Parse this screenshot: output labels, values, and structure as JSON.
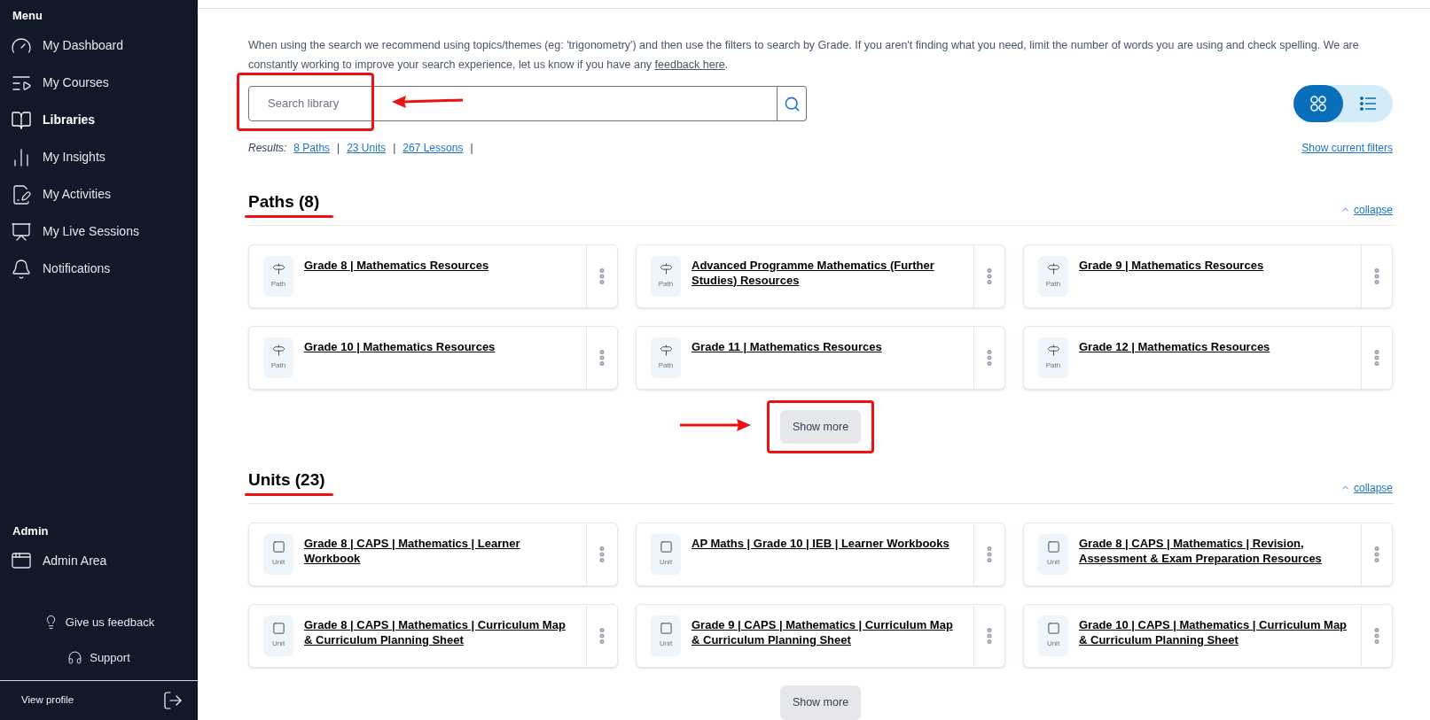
{
  "sidebar": {
    "menu_heading": "Menu",
    "items": [
      {
        "kind": "dashboard",
        "label": "My Dashboard",
        "selected": false
      },
      {
        "kind": "courses",
        "label": "My Courses",
        "selected": false
      },
      {
        "kind": "libraries",
        "label": "Libraries",
        "selected": true
      },
      {
        "kind": "insights",
        "label": "My Insights",
        "selected": false
      },
      {
        "kind": "activities",
        "label": "My Activities",
        "selected": false
      },
      {
        "kind": "live",
        "label": "My Live Sessions",
        "selected": false
      },
      {
        "kind": "notifications",
        "label": "Notifications",
        "selected": false
      }
    ],
    "admin_heading": "Admin",
    "admin_items": [
      {
        "kind": "admin",
        "label": "Admin Area",
        "selected": false
      }
    ],
    "feedback": "Give us feedback",
    "support": "Support",
    "profile": "View profile"
  },
  "intro": {
    "text": "When using the search we recommend using topics/themes (eg: 'trigonometry') and then use the filters to search by Grade. If you aren't finding what you need, limit the number of words you are using and check spelling. We are constantly working to improve your search experience, let us know if you have any ",
    "link": "feedback here",
    "after": "."
  },
  "search": {
    "placeholder": "Search library",
    "marked": true
  },
  "view_toggle": [
    {
      "kind": "grid",
      "selected": true
    },
    {
      "kind": "list",
      "selected": false
    }
  ],
  "results": {
    "label": "Results:",
    "links": [
      "8 Paths",
      "23 Units",
      "267 Lessons"
    ],
    "separator": "|",
    "filters_link": "Show current filters"
  },
  "sections": [
    {
      "title": "Paths (8)",
      "marked": true,
      "collapse": "collapse",
      "show_more": "Show more",
      "show_more_marked": true,
      "cards": [
        {
          "kind": "path",
          "title": "Grade 8 | Mathematics Resources",
          "type_label": "Path"
        },
        {
          "kind": "path",
          "title": "Advanced Programme Mathematics (Further Studies) Resources",
          "type_label": "Path"
        },
        {
          "kind": "path",
          "title": "Grade 9 | Mathematics Resources",
          "type_label": "Path"
        },
        {
          "kind": "path",
          "title": "Grade 10 | Mathematics Resources",
          "type_label": "Path"
        },
        {
          "kind": "path",
          "title": "Grade 11 | Mathematics Resources",
          "type_label": "Path"
        },
        {
          "kind": "path",
          "title": "Grade 12 | Mathematics Resources",
          "type_label": "Path"
        }
      ]
    },
    {
      "title": "Units (23)",
      "marked": true,
      "collapse": "collapse",
      "show_more": "Show more",
      "show_more_marked": false,
      "cards": [
        {
          "kind": "unit",
          "title": "Grade 8 | CAPS | Mathematics | Learner Workbook",
          "type_label": "Unit"
        },
        {
          "kind": "unit",
          "title": "AP Maths | Grade 10 | IEB | Learner Workbooks",
          "type_label": "Unit"
        },
        {
          "kind": "unit",
          "title": "Grade 8 | CAPS | Mathematics | Revision, Assessment & Exam Preparation Resources",
          "type_label": "Unit"
        },
        {
          "kind": "unit",
          "title": "Grade 8 | CAPS | Mathematics | Curriculum Map & Curriculum Planning Sheet",
          "type_label": "Unit"
        },
        {
          "kind": "unit",
          "title": "Grade 9 | CAPS | Mathematics | Curriculum Map & Curriculum Planning Sheet",
          "type_label": "Unit"
        },
        {
          "kind": "unit",
          "title": "Grade 10 | CAPS | Mathematics | Curriculum Map & Curriculum Planning Sheet",
          "type_label": "Unit"
        }
      ]
    }
  ]
}
